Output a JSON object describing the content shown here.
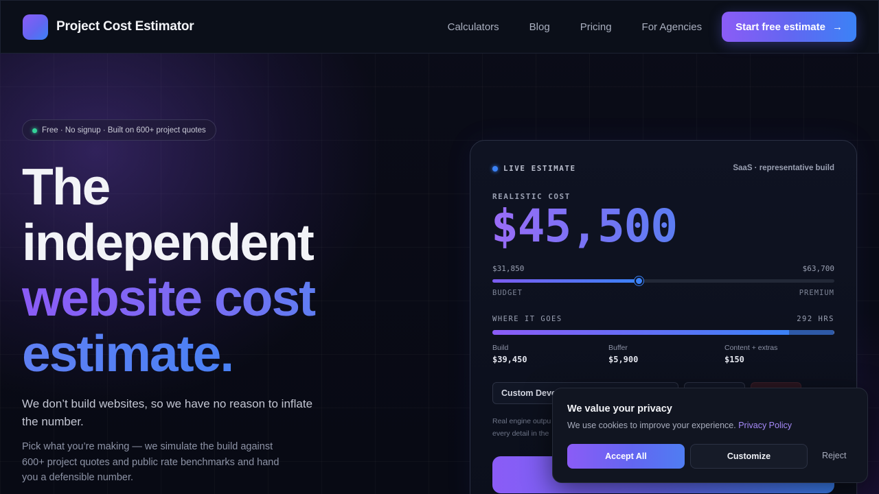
{
  "nav": {
    "brand": "Project Cost Estimator",
    "links": [
      "Calculators",
      "Blog",
      "Pricing",
      "For Agencies"
    ],
    "cta_label": "Start free estimate",
    "cta_icon": "arrow-right-icon"
  },
  "hero": {
    "pill": "Free · No signup · Built on 600+ project quotes",
    "headline": [
      "The",
      "independent",
      "website cost",
      "estimate."
    ],
    "sub1": "We don’t build websites, so we have no reason to inflate the number.",
    "sub2": "Pick what you’re making — we simulate the build against 600+ project quotes and public rate benchmarks and hand you a defensible number."
  },
  "estimate": {
    "live_label": "LIVE ESTIMATE",
    "type": "SaaS · representative build",
    "cost_label": "REALISTIC COST",
    "cost": "$45,500",
    "range_low": "$31,850",
    "range_high": "$63,700",
    "slider_position": 0.428,
    "budget_label": "BUDGET",
    "premium_label": "PREMIUM",
    "where_label": "WHERE IT GOES",
    "hours": "292 HRS",
    "breakdown": [
      {
        "name": "Build",
        "value": "$39,450",
        "share": 0.867
      },
      {
        "name": "Buffer",
        "value": "$5,900",
        "share": 0.13
      },
      {
        "name": "Content + extras",
        "value": "$150",
        "share": 0.003
      }
    ],
    "chip_label": "Custom Devel",
    "note": "Real engine outpu every detail in the"
  },
  "cookie": {
    "title": "We value your privacy",
    "text": "We use cookies to improve your experience.",
    "link": "Privacy Policy",
    "accept": "Accept All",
    "customize": "Customize",
    "reject": "Reject"
  },
  "colors": {
    "accent_purple": "#8b5cf6",
    "accent_blue": "#3b82f6",
    "live_dot": "#3b82f6",
    "status_dot": "#34d399"
  }
}
